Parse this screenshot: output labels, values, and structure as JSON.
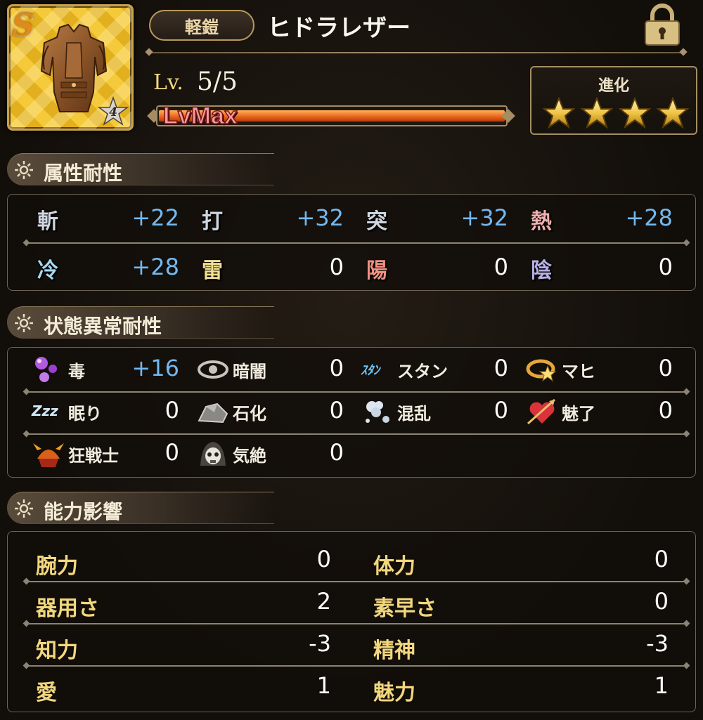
{
  "header": {
    "rank": "S",
    "star_rank": "4",
    "category": "軽鎧",
    "name": "ヒドラレザー",
    "lv_label": "Lv.",
    "lv_value": "5/5",
    "xp_label": "LvMax",
    "xp_progress": 1.0,
    "evolution_title": "進化",
    "evolution_stars": 4,
    "lock_icon": "padlock-icon"
  },
  "sections": {
    "attribute": "属性耐性",
    "status": "状態異常耐性",
    "ability": "能力影響"
  },
  "attributes": [
    {
      "glyph": "斬",
      "value": "+22",
      "color": "#d0d6e0",
      "icon": "slash-icon"
    },
    {
      "glyph": "打",
      "value": "+32",
      "color": "#d0d6e0",
      "icon": "blunt-icon"
    },
    {
      "glyph": "突",
      "value": "+32",
      "color": "#d0d6e0",
      "icon": "pierce-icon"
    },
    {
      "glyph": "熱",
      "value": "+28",
      "color": "#f0b0b0",
      "icon": "heat-icon"
    },
    {
      "glyph": "冷",
      "value": "+28",
      "color": "#a8d8f0",
      "icon": "cold-icon"
    },
    {
      "glyph": "雷",
      "value": "0",
      "color": "#f0e090",
      "icon": "thunder-icon"
    },
    {
      "glyph": "陽",
      "value": "0",
      "color": "#f09080",
      "icon": "light-icon"
    },
    {
      "glyph": "陰",
      "value": "0",
      "color": "#b8b0e8",
      "icon": "dark-icon"
    }
  ],
  "status_effects": [
    {
      "label": "毒",
      "value": "+16",
      "icon": "poison-icon"
    },
    {
      "label": "暗闇",
      "value": "0",
      "icon": "darkness-eye-icon"
    },
    {
      "label": "スタン",
      "value": "0",
      "icon": "stun-icon",
      "icon_text": "ｽﾀﾝ"
    },
    {
      "label": "マヒ",
      "value": "0",
      "icon": "paralysis-icon"
    },
    {
      "label": "眠り",
      "value": "0",
      "icon": "sleep-icon",
      "icon_text": "Zzz"
    },
    {
      "label": "石化",
      "value": "0",
      "icon": "petrify-icon"
    },
    {
      "label": "混乱",
      "value": "0",
      "icon": "confusion-icon"
    },
    {
      "label": "魅了",
      "value": "0",
      "icon": "charm-heart-icon"
    },
    {
      "label": "狂戦士",
      "value": "0",
      "icon": "berserk-icon"
    },
    {
      "label": "気絶",
      "value": "0",
      "icon": "faint-skull-icon"
    }
  ],
  "abilities": [
    {
      "label": "腕力",
      "value": "0"
    },
    {
      "label": "体力",
      "value": "0"
    },
    {
      "label": "器用さ",
      "value": "2"
    },
    {
      "label": "素早さ",
      "value": "0"
    },
    {
      "label": "知力",
      "value": "-3"
    },
    {
      "label": "精神",
      "value": "-3"
    },
    {
      "label": "愛",
      "value": "1"
    },
    {
      "label": "魅力",
      "value": "1"
    }
  ]
}
